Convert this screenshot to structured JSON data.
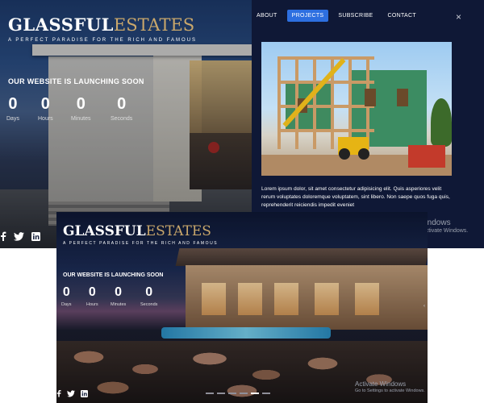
{
  "top": {
    "brand": {
      "part1": "GLASSFUL",
      "part2": "ESTATES"
    },
    "tagline": "A PERFECT PARADISE FOR THE RICH AND FAMOUS",
    "launch": "OUR WEBSITE IS LAUNCHING SOON",
    "countdown": [
      {
        "value": "0",
        "label": "Days"
      },
      {
        "value": "0",
        "label": "Hours"
      },
      {
        "value": "0",
        "label": "Minutes"
      },
      {
        "value": "0",
        "label": "Seconds"
      }
    ],
    "social": [
      "facebook-icon",
      "twitter-icon",
      "linkedin-icon"
    ],
    "nav": [
      {
        "label": "ABOUT"
      },
      {
        "label": "PROJECTS"
      },
      {
        "label": "SUBSCRIBE"
      },
      {
        "label": "CONTACT"
      }
    ],
    "close_icon": "×",
    "modal_text": "Lorem ipsum dolor, sit amet consectetur adipisicing elit. Quis asperiores velit rerum voluptates doloremque voluptatem, sint libero. Non saepe quos fuga quis, reprehenderit reiciendis impedit eveniet",
    "watermark": {
      "line1": "Windows",
      "line2": "o activate Windows."
    },
    "accent": "#2d6fe0",
    "gold": "#c9a76b"
  },
  "bottom": {
    "brand": {
      "part1": "GLASSFUL",
      "part2": "ESTATES"
    },
    "tagline": "A PERFECT PARADISE FOR THE RICH AND FAMOUS",
    "launch": "OUR WEBSITE IS LAUNCHING SOON",
    "countdown": [
      {
        "value": "0",
        "label": "Days"
      },
      {
        "value": "0",
        "label": "Hours"
      },
      {
        "value": "0",
        "label": "Minutes"
      },
      {
        "value": "0",
        "label": "Seconds"
      }
    ],
    "social": [
      "facebook-icon",
      "twitter-icon",
      "linkedin-icon"
    ],
    "scroll_arrow": "‹",
    "watermark": {
      "line1": "Activate Windows",
      "line2": "Go to Settings to activate Windows."
    }
  }
}
